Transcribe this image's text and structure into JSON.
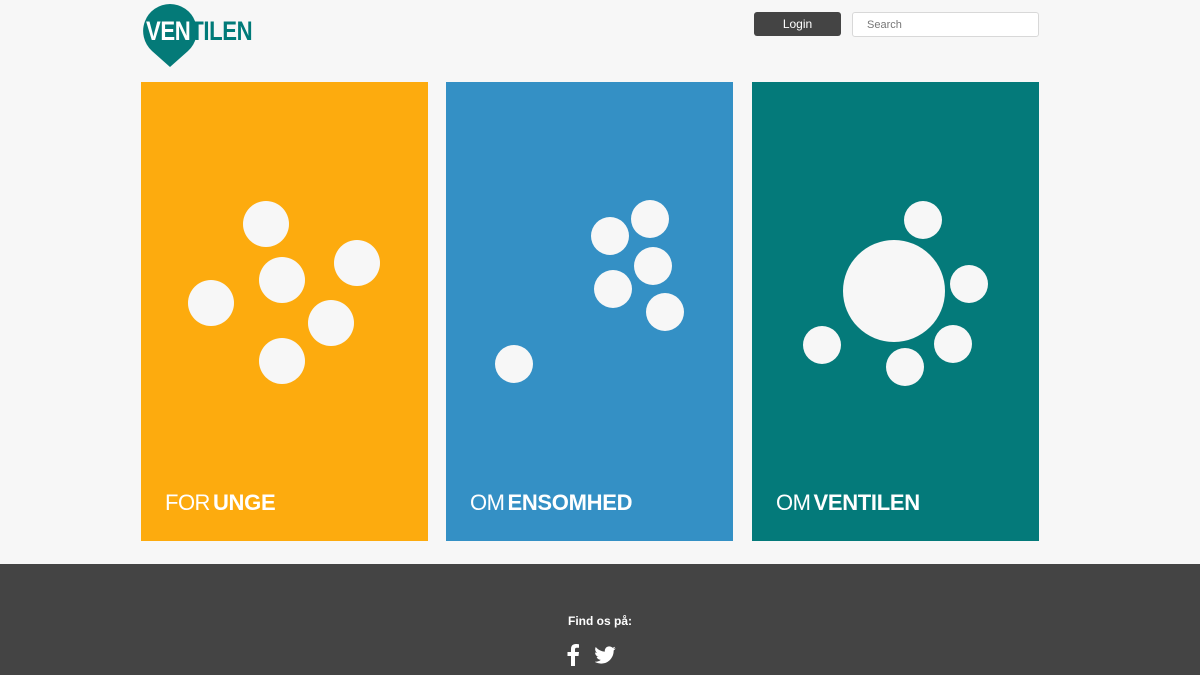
{
  "header": {
    "logo": {
      "part_in": "VEN",
      "part_out": "TILEN",
      "color": "#007a78"
    },
    "login_label": "Login",
    "search_placeholder": "Search"
  },
  "panels": [
    {
      "light": "FOR",
      "bold": "UNGE",
      "color": "#fdab0e"
    },
    {
      "light": "OM",
      "bold": "ENSOMHED",
      "color": "#3490c5"
    },
    {
      "light": "OM",
      "bold": "VENTILEN",
      "color": "#047a7a"
    }
  ],
  "footer": {
    "title": "Find os på:",
    "icons": [
      "facebook-icon",
      "twitter-icon"
    ],
    "background": "#444444"
  }
}
